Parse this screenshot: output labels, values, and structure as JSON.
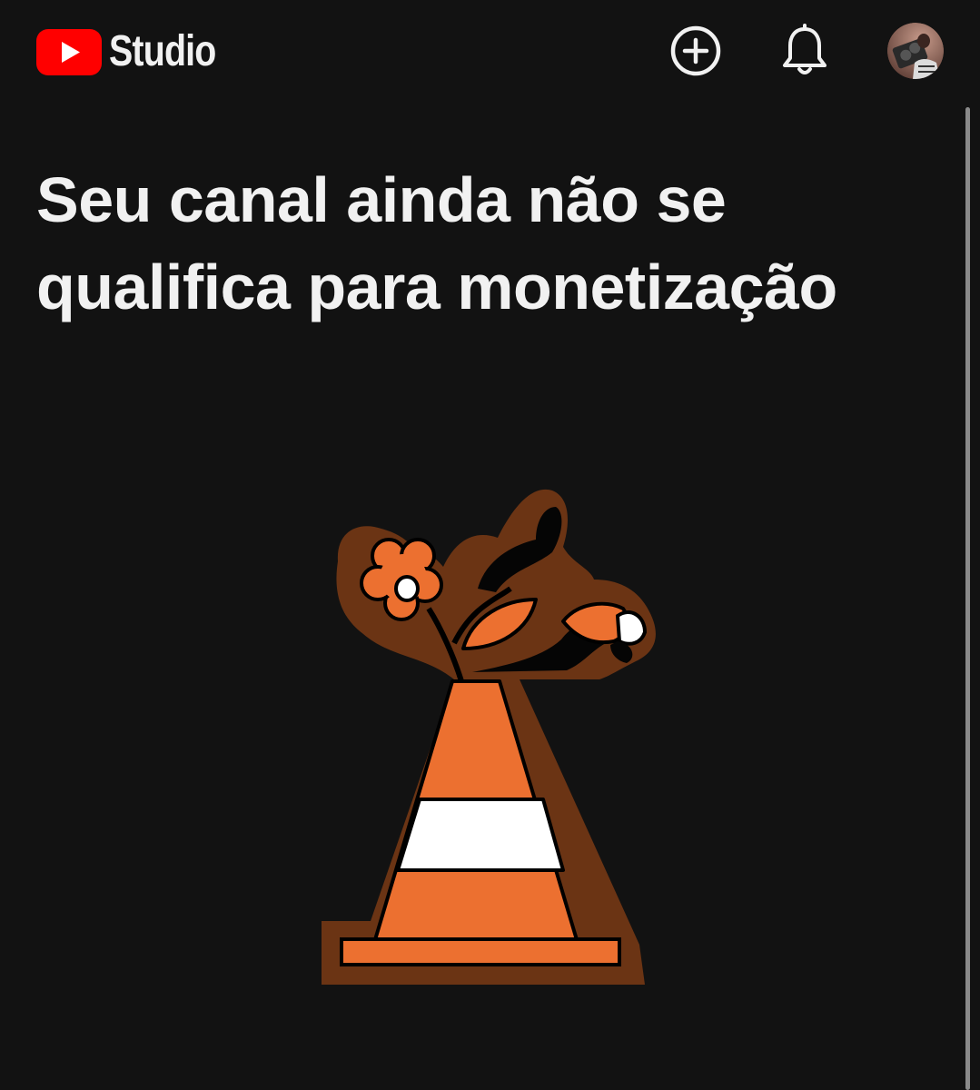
{
  "header": {
    "logo_text": "Studio",
    "brand_color": "#ff0000",
    "create_icon": "add-circle-icon",
    "notifications_icon": "bell-icon",
    "avatar_icon": "user-avatar"
  },
  "main": {
    "title": "Seu canal ainda não se qualifica para monetização",
    "illustration": "traffic-cone-with-flowers"
  },
  "colors": {
    "background": "#121212",
    "text": "#f1f1f1",
    "cone_orange": "#ec7030",
    "cone_outline": "#6b3414"
  }
}
